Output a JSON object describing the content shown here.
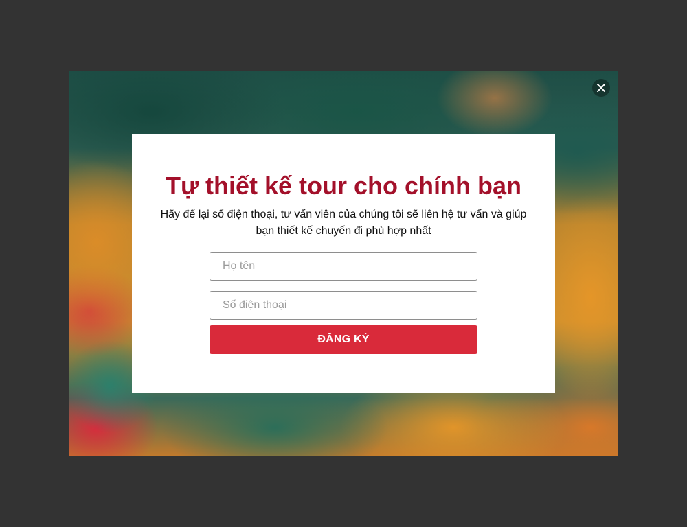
{
  "popup": {
    "close_icon": "close-icon",
    "title": "Tự thiết kế tour cho chính bạn",
    "subtitle": "Hãy để lại số điện thoại, tư vấn viên của chúng tôi sẽ liên hệ tư vấn và giúp bạn thiết kế chuyến đi phù hợp nhất",
    "fields": {
      "name": {
        "placeholder": "Họ tên",
        "value": ""
      },
      "phone": {
        "placeholder": "Số điện thoại",
        "value": ""
      }
    },
    "submit_label": "ĐĂNG KÝ"
  },
  "colors": {
    "title": "#a3102a",
    "button": "#d92a3a",
    "overlay": "#333333"
  }
}
